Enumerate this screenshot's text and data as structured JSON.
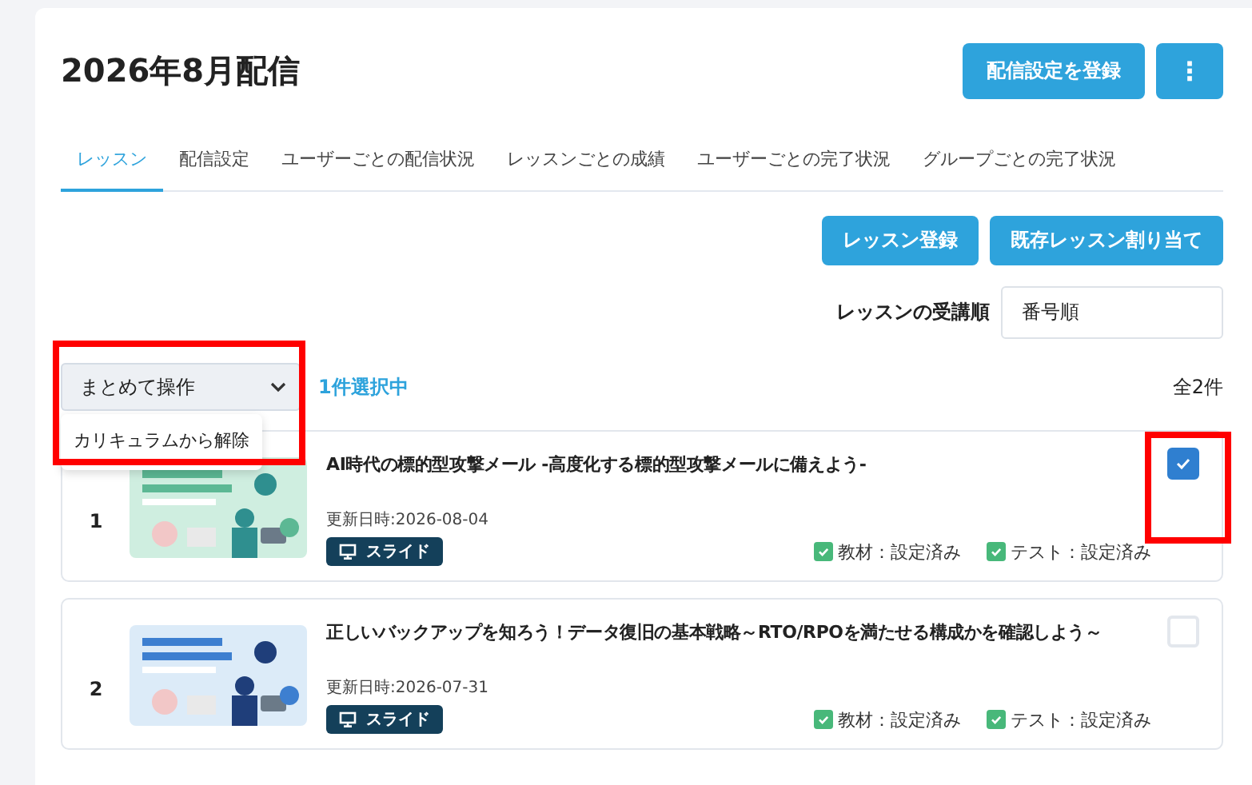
{
  "header": {
    "title": "2026年8月配信",
    "primary_button": "配信設定を登録",
    "more_button": "⋮"
  },
  "tabs": [
    {
      "label": "レッスン",
      "selected": true
    },
    {
      "label": "配信設定",
      "selected": false
    },
    {
      "label": "ユーザーごとの配信状況",
      "selected": false
    },
    {
      "label": "レッスンごとの成績",
      "selected": false
    },
    {
      "label": "ユーザーごとの完了状況",
      "selected": false
    },
    {
      "label": "グループごとの完了状況",
      "selected": false
    }
  ],
  "actions": [
    "レッスン登録",
    "既存レッスン割り当て"
  ],
  "order": {
    "label": "レッスンの受講順",
    "value": "番号順"
  },
  "bulk_action": {
    "label": "まとめて操作",
    "expanded": true,
    "highlighted": true,
    "menu": [
      "カリキュラムから解除"
    ]
  },
  "selection_count": "1件選択中",
  "total": "全2件",
  "lessons": [
    {
      "number": "1",
      "title": "AI時代の標的型攻撃メール -高度化する標的型攻撃メールに備えよう-",
      "updated": "更新日時:2026-08-04",
      "type": "スライド",
      "statuses": [
        "教材：設定済み",
        "テスト：設定済み"
      ],
      "checked": true,
      "highlighted": true
    },
    {
      "number": "2",
      "title": "正しいバックアップを知ろう！データ復旧の基本戦略～RTO/RPOを満たせる構成かを確認しよう～",
      "updated": "更新日時:2026-07-31",
      "type": "スライド",
      "statuses": [
        "教材：設定済み",
        "テスト：設定済み"
      ],
      "checked": false,
      "highlighted": false
    }
  ]
}
